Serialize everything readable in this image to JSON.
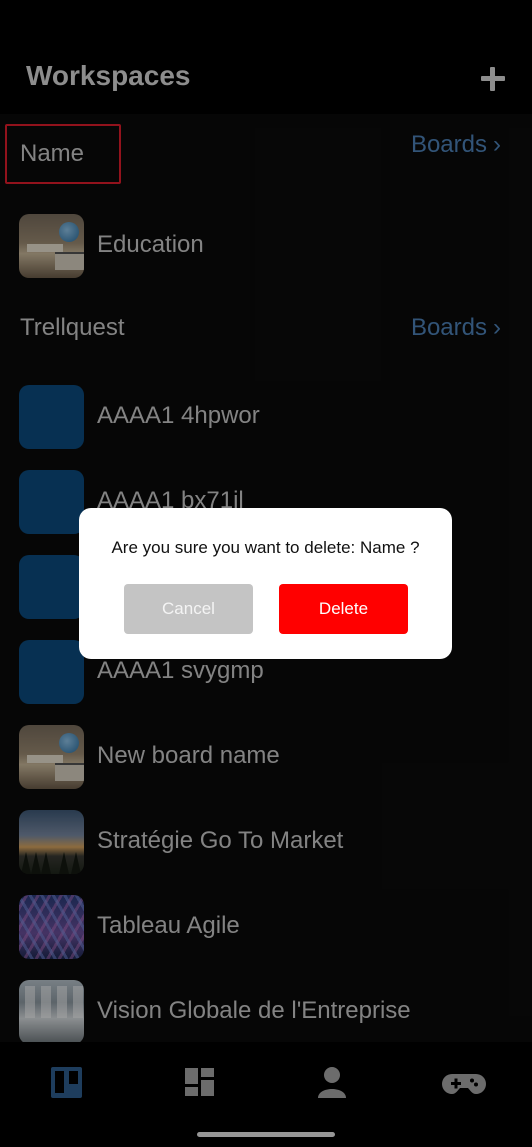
{
  "header": {
    "title": "Workspaces",
    "add_icon": "plus-icon"
  },
  "workspaces": [
    {
      "name": "Name",
      "boards_label": "Boards",
      "boards_icon": "chevron-right-icon",
      "boards": [
        {
          "label": "Education",
          "thumbnail": "books-globe-photo"
        }
      ]
    },
    {
      "name": "Trellquest",
      "boards_label": "Boards",
      "boards_icon": "chevron-right-icon",
      "boards": [
        {
          "label": "AAAA1 4hpwor",
          "thumbnail": "blue-square"
        },
        {
          "label": "AAAA1 bx71il",
          "thumbnail": "blue-square"
        },
        {
          "label": "",
          "thumbnail": "blue-square"
        },
        {
          "label": "AAAA1 svygmp",
          "thumbnail": "blue-square"
        },
        {
          "label": "New board name",
          "thumbnail": "books-globe-photo"
        },
        {
          "label": "Stratégie Go To Market",
          "thumbnail": "mountain-sunset-photo"
        },
        {
          "label": "Tableau Agile",
          "thumbnail": "geometric-glass-photo"
        },
        {
          "label": "Vision Globale de l'Entreprise",
          "thumbnail": "office-room-photo"
        }
      ]
    }
  ],
  "dialog": {
    "message": "Are you sure you want to delete: Name ?",
    "cancel_label": "Cancel",
    "delete_label": "Delete"
  },
  "tabbar": {
    "tabs": [
      {
        "icon": "boards-icon",
        "active": true
      },
      {
        "icon": "dashboard-icon",
        "active": false
      },
      {
        "icon": "user-icon",
        "active": false
      },
      {
        "icon": "gamepad-icon",
        "active": false
      }
    ]
  },
  "colors": {
    "accent_blue": "#4d82b8",
    "active_tab": "#2f5f8f",
    "inactive_tab": "#a6a6a6",
    "delete_red": "#ff0000",
    "cancel_gray": "#c4c4c4",
    "highlight_red": "#e11d2b"
  }
}
